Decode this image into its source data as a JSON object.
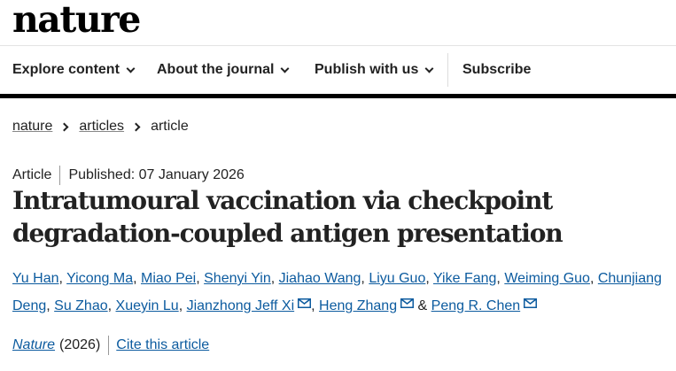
{
  "site": {
    "logo_text": "nature"
  },
  "nav": {
    "items": [
      {
        "label": "Explore content"
      },
      {
        "label": "About the journal"
      },
      {
        "label": "Publish with us"
      }
    ],
    "subscribe_label": "Subscribe"
  },
  "breadcrumb": {
    "items": [
      "nature",
      "articles"
    ],
    "current": "article"
  },
  "article": {
    "type": "Article",
    "published": "Published: 07 January 2026",
    "title": "Intratumoural vaccination via checkpoint degradation-coupled antigen presentation",
    "authors": [
      {
        "name": "Yu Han",
        "sep": ", "
      },
      {
        "name": "Yicong Ma",
        "sep": ", "
      },
      {
        "name": "Miao Pei",
        "sep": ", "
      },
      {
        "name": "Shenyi Yin",
        "sep": ", "
      },
      {
        "name": "Jiahao Wang",
        "sep": ", "
      },
      {
        "name": "Liyu Guo",
        "sep": ", "
      },
      {
        "name": "Yike Fang",
        "sep": ", "
      },
      {
        "name": "Weiming Guo",
        "sep": ", "
      },
      {
        "name": "Chunjiang Deng",
        "sep": ", "
      },
      {
        "name": "Su Zhao",
        "sep": ", "
      },
      {
        "name": "Xueyin Lu",
        "sep": ", "
      },
      {
        "name": "Jianzhong Jeff Xi",
        "sep": ", "
      },
      {
        "name": "Heng Zhang",
        "sep": " & "
      },
      {
        "name": "Peng R. Chen",
        "sep": ""
      }
    ],
    "journal": "Nature",
    "year": "(2026)",
    "cite_label": "Cite this article"
  },
  "colors": {
    "link": "#0c5b9f",
    "text": "#222222",
    "rule": "#000000"
  },
  "icons": {
    "mail": "envelope-icon",
    "chevron": "chevron-down-icon",
    "crumb": "chevron-right-icon"
  }
}
